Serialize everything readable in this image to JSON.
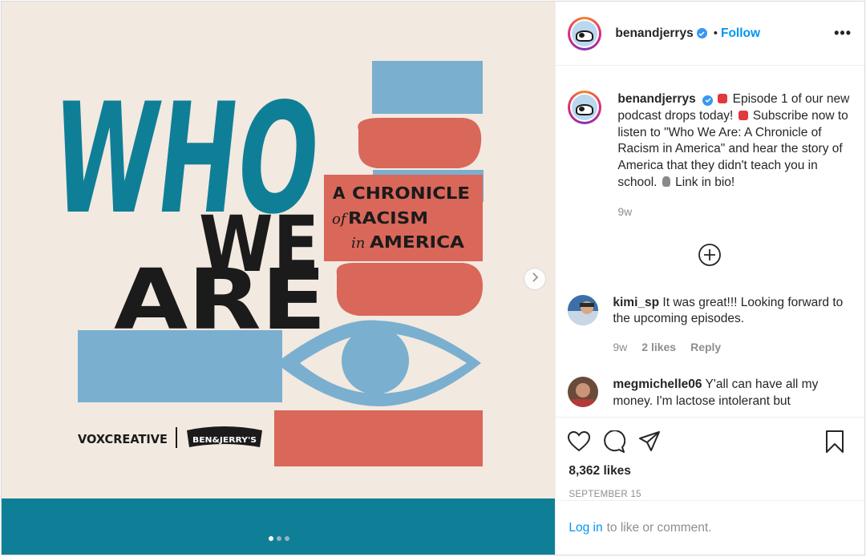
{
  "post": {
    "username": "benandjerrys",
    "follow_label": "Follow",
    "separator": "•",
    "more_label": "•••"
  },
  "artwork": {
    "line1": "WHO",
    "line2": "WE",
    "line3": "ARE",
    "subtitle_a": "A",
    "subtitle_chronicle": "CHRONICLE",
    "subtitle_of": "of",
    "subtitle_racism": "RACISM",
    "subtitle_in": "in",
    "subtitle_america": "AMERICA",
    "brand_vox": "VOXCREATIVE",
    "brand_bj": "BEN&JERRY'S",
    "colors": {
      "teal": "#0f7f97",
      "blue": "#7aafcf",
      "coral": "#d9675a",
      "cream": "#f2e9e0",
      "black": "#1b1b1b"
    }
  },
  "carousel": {
    "total": 3,
    "active": 1
  },
  "caption": {
    "username": "benandjerrys",
    "text_before_1": "Episode 1 of our new podcast drops today!",
    "text_before_2": "Subscribe now to listen to \"Who We Are: A Chronicle of Racism in America\" and hear the story of America that they didn't teach you in school.",
    "text_after": "Link in bio!",
    "time": "9w"
  },
  "comments": [
    {
      "username": "kimi_sp",
      "text": "It was great!!! Looking forward to the upcoming episodes.",
      "time": "9w",
      "likes": "2 likes",
      "reply": "Reply"
    },
    {
      "username": "megmichelle06",
      "text": "Y'all can have all my money. I'm lactose intolerant but"
    }
  ],
  "stats": {
    "likes": "8,362 likes",
    "date": "SEPTEMBER 15"
  },
  "login": {
    "link": "Log in",
    "rest": "to like or comment."
  }
}
